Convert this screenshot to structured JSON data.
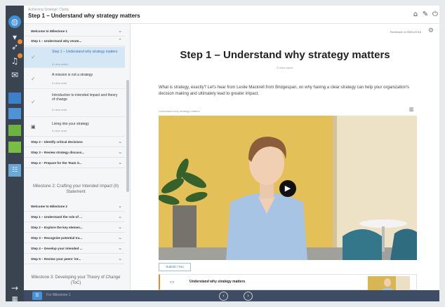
{
  "header": {
    "breadcrumb": "Achieving Strategic Clarity",
    "title": "Step 1 – Understand why strategy matters",
    "icons": [
      "home-icon",
      "pin-icon",
      "power-icon"
    ]
  },
  "rail": {
    "icons": [
      "globe-icon",
      "rocket-icon",
      "bell-icon",
      "mail-icon",
      "blue-tile-icon",
      "blue-tile-icon",
      "green-tile-icon",
      "green-tile-icon",
      "contact-card-icon",
      "arrow-right-icon",
      "grid-icon"
    ],
    "tile_colors": [
      "#3d7fc9",
      "#4f93d6",
      "#6cb33f",
      "#79bd45"
    ]
  },
  "sidebar": {
    "rows_top": [
      {
        "label": "Welcome to Milestone 1",
        "chev": "⌄"
      },
      {
        "label": "Step 1 – Understand why strate...",
        "chev": "⌃"
      }
    ],
    "steps": [
      {
        "title": "Step 1 – Understand why strategy matters",
        "meta": "8 mins watch",
        "done": true,
        "active": true
      },
      {
        "title": "A mission is not a strategy",
        "meta": "5 mins read",
        "done": true,
        "active": false
      },
      {
        "title": "Introduction to intended impact and theory of change",
        "meta": "5 mins read",
        "done": true,
        "active": false
      },
      {
        "title": "Living into your strategy",
        "meta": "5 mins read",
        "done": false,
        "active": false
      }
    ],
    "rows_mid": [
      {
        "label": "Step 2 – Identify critical decisions",
        "chev": "⌄"
      },
      {
        "label": "Step 3 – Review strategy discuss...",
        "chev": "⌄"
      },
      {
        "label": "Step 4 – Prepare for the Team S...",
        "chev": "⌄"
      }
    ],
    "milestone2": "Milestone 2: Crafting your Intended Impact (II) Statement",
    "rows_m2": [
      {
        "label": "Welcome to Milestone 2",
        "chev": "⌄"
      },
      {
        "label": "Step 1 – Understand the role of ...",
        "chev": "⌄"
      },
      {
        "label": "Step 2 – Explore the key elemen...",
        "chev": "⌄"
      },
      {
        "label": "Step 3 – Recognize potential tra...",
        "chev": "⌄"
      },
      {
        "label": "Step 4 – Develop your intended ...",
        "chev": "⌄"
      },
      {
        "label": "Step 5 – Review your peers' int...",
        "chev": "⌄"
      }
    ],
    "milestone3": "Milestone 3: Developing your Theory of Change (ToC)"
  },
  "main": {
    "reviewed": "Reviewed on 08/01/2018",
    "title": "Step 1 – Understand why strategy matters",
    "subtitle": "8 mins watch",
    "intro": "What is strategy, exactly? Let's hear from Leslie Mackrell from Bridgespan, on why having a clear strategy can help your organization's decision making and ultimately lead to greater impact.",
    "video_label": "Understand why strategy matters",
    "submit_tab": "Submit / You",
    "card_title": "Understand why strategy matters"
  },
  "bottombar": {
    "label": "For Milestone 1",
    "prev": "‹",
    "next": "›"
  }
}
